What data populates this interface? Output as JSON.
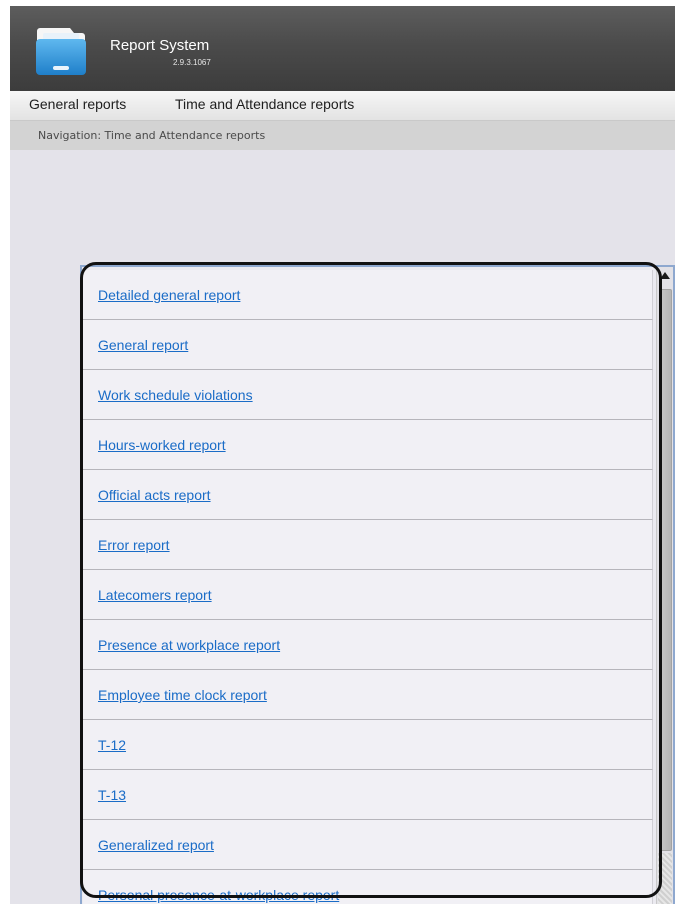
{
  "header": {
    "title": "Report System",
    "version": "2.9.3.1067",
    "logo_icon": "folder-icon"
  },
  "menu": {
    "items": [
      {
        "label": "General reports"
      },
      {
        "label": "Time and Attendance reports"
      }
    ]
  },
  "breadcrumb": {
    "text": "Navigation: Time and Attendance reports"
  },
  "reports": {
    "items": [
      {
        "label": "Detailed general report"
      },
      {
        "label": "General report"
      },
      {
        "label": "Work schedule violations"
      },
      {
        "label": "Hours-worked report"
      },
      {
        "label": "Official acts report"
      },
      {
        "label": "Error report"
      },
      {
        "label": "Latecomers report"
      },
      {
        "label": "Presence at workplace report"
      },
      {
        "label": "Employee time clock report"
      },
      {
        "label": "T-12"
      },
      {
        "label": "T-13"
      },
      {
        "label": "Generalized report"
      },
      {
        "label": "Personal presence-at-workplace report"
      }
    ]
  },
  "colors": {
    "header_bg": "#4b4b4b",
    "link": "#1a6cc7",
    "panel_border": "#8ea8cf",
    "content_bg": "#e4e3ea"
  }
}
